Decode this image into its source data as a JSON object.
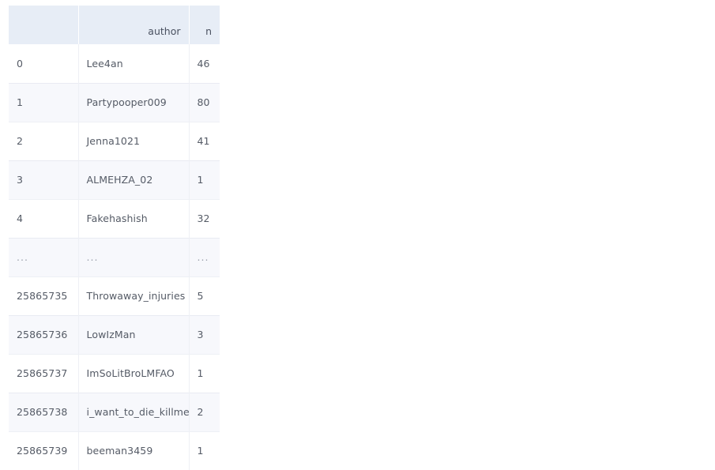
{
  "table": {
    "columns": [
      "",
      "author",
      "n"
    ],
    "rows": [
      {
        "index": "0",
        "author": "Lee4an",
        "n": "46"
      },
      {
        "index": "1",
        "author": "Partypooper009",
        "n": "80"
      },
      {
        "index": "2",
        "author": "Jenna1021",
        "n": "41"
      },
      {
        "index": "3",
        "author": "ALMEHZA_02",
        "n": "1"
      },
      {
        "index": "4",
        "author": "Fakehashish",
        "n": "32"
      },
      {
        "index": "...",
        "author": "...",
        "n": "..."
      },
      {
        "index": "25865735",
        "author": "Throwaway_injuries",
        "n": "5"
      },
      {
        "index": "25865736",
        "author": "LowIzMan",
        "n": "3"
      },
      {
        "index": "25865737",
        "author": "ImSoLitBroLMFAO",
        "n": "1"
      },
      {
        "index": "25865738",
        "author": "i_want_to_die_killme",
        "n": "2"
      },
      {
        "index": "25865739",
        "author": "beeman3459",
        "n": "1"
      }
    ],
    "colors": {
      "header_background": "#e7edf6",
      "row_background": "#ffffff",
      "row_background_alt": "#f7f8fc",
      "text": "#555b66",
      "border": "#eef0f5",
      "page_background": "#ffffff"
    }
  }
}
